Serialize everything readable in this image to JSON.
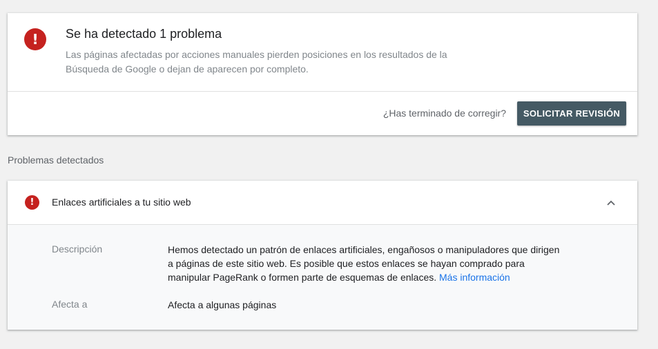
{
  "summary": {
    "icon": "alert-icon",
    "title": "Se ha detectado 1 problema",
    "description": "Las páginas afectadas por acciones manuales pierden posiciones en los resultados de la Búsqueda de Google o dejan de aparecen por completo.",
    "fixed_question": "¿Has terminado de corregir?",
    "request_review_label": "SOLICITAR REVISIÓN"
  },
  "issues_section": {
    "heading": "Problemas detectados",
    "issues": [
      {
        "icon": "alert-icon",
        "title": "Enlaces artificiales a tu sitio web",
        "expanded": true,
        "description_label": "Descripción",
        "description_text": "Hemos detectado un patrón de enlaces artificiales, engañosos o manipuladores que dirigen a páginas de este sitio web. Es posible que estos enlaces se hayan comprado para manipular PageRank o formen parte de esquemas de enlaces.",
        "more_info_label": "Más información",
        "affects_label": "Afecta a",
        "affects_value": "Afecta a algunas páginas"
      }
    ]
  },
  "colors": {
    "alert_red": "#c5221f",
    "button_bg": "#455a64",
    "link_blue": "#1a73e8"
  }
}
